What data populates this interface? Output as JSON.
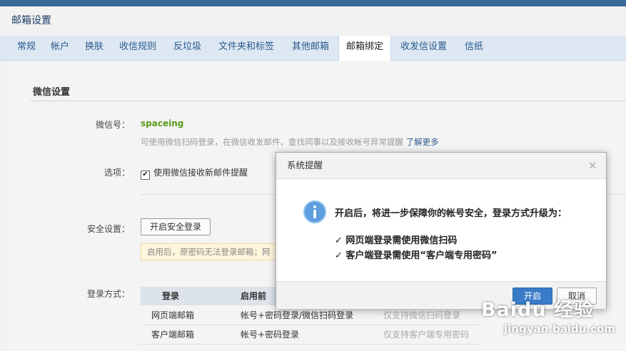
{
  "page": {
    "title": "邮箱设置"
  },
  "tabs": [
    "常规",
    "帐户",
    "换肤",
    "收信规则",
    "反垃圾",
    "文件夹和标签",
    "其他邮箱",
    "邮箱绑定",
    "收发信设置",
    "信纸"
  ],
  "active_tab": "邮箱绑定",
  "section": {
    "title": "微信设置",
    "wechat_label": "微信号：",
    "wechat_id": "spaceing",
    "wechat_hint": "可使用微信扫码登录，在微信收发邮件、查找同事以及接收帐号异常提醒",
    "learn_more": "了解更多",
    "option_label": "选项：",
    "option_checkbox": "使用微信接收新邮件提醒",
    "option_checked": true,
    "secure_label": "安全设置：",
    "secure_button": "开启安全登录",
    "secure_warning": "启用后，原密码无法登录邮箱；网",
    "login_label": "登录方式："
  },
  "login_table": {
    "headers": [
      "登录",
      "启用前",
      ""
    ],
    "rows": [
      {
        "type": "网页端邮箱",
        "before": "帐号+密码登录/微信扫码登录",
        "after": "仅支持微信扫码登录"
      },
      {
        "type": "客户端邮箱",
        "before": "帐号+密码登录",
        "after": "仅支持客户端专用密码"
      }
    ]
  },
  "dialog": {
    "title": "系统提醒",
    "close_glyph": "×",
    "message": "开启后，将进一步保障你的帐号安全，登录方式升级为：",
    "items": [
      "✓ 网页端登录需使用微信扫码",
      "✓ 客户端登录需使用“客户端专用密码”"
    ],
    "ok_button": "开启",
    "cancel_button": "取消"
  },
  "watermark": {
    "brand": "Baidu 经验",
    "url": "jingyan.baidu.com"
  },
  "colors": {
    "accent": "#3a7cc8",
    "tab_bg": "#dde8f3",
    "wechat_id": "#5a9a1a",
    "info_icon": "#5c9ede"
  },
  "icons": {
    "dialog": "info-icon",
    "checkbox": "checkbox-checked"
  }
}
